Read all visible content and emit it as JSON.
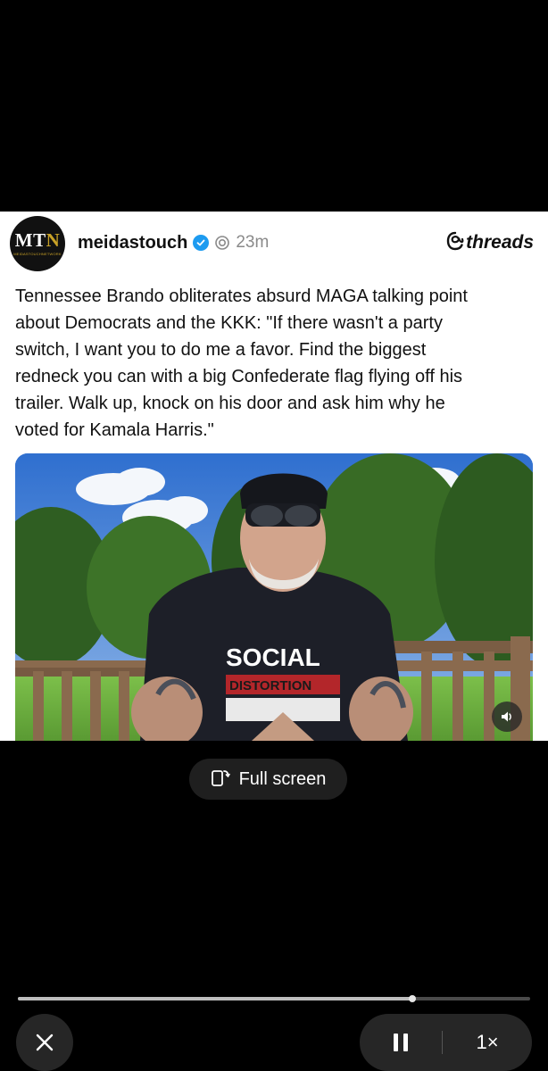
{
  "post": {
    "avatar_text_m": "MT",
    "avatar_text_n": "N",
    "avatar_subtext": "MEIDASTOUCHNETWORK",
    "username": "meidastouch",
    "time": "23m",
    "brand": "threads",
    "text_lines": [
      "Tennessee Brando obliterates absurd MAGA talking point",
      "about Democrats and the KKK: \"If there wasn't a party",
      "switch, I want you to do me a favor. Find the biggest",
      "redneck you can with a big Confederate flag flying off his",
      "trailer. Walk up, knock on his door and ask him why he",
      "voted for Kamala Harris.\""
    ],
    "shirt_text_top": "SOCIAL",
    "shirt_text_mid": "DISTORTION"
  },
  "player": {
    "fullscreen_label": "Full screen",
    "speed_label": "1×",
    "progress": 0.77
  },
  "colors": {
    "verified": "#1d9bf0",
    "brand_gold": "#c9a227"
  }
}
